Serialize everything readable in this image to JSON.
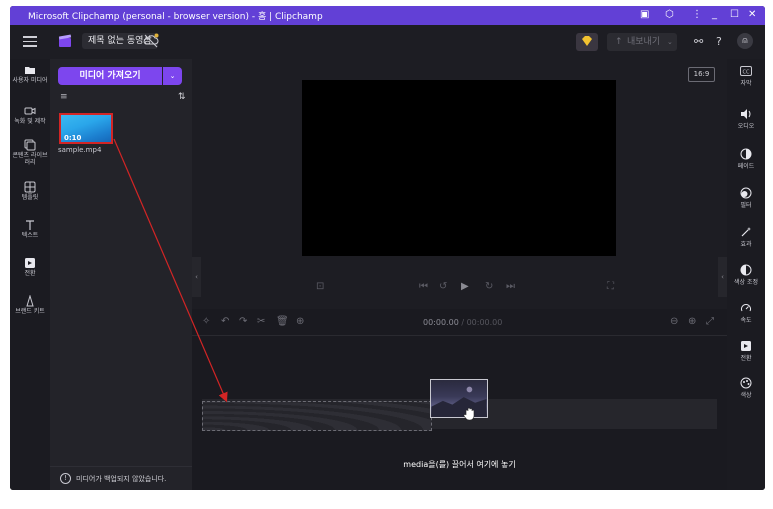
{
  "titlebar": {
    "title": "Microsoft Clipchamp (personal - browser version) - 홈 | Clipchamp"
  },
  "appbar": {
    "project_title": "제목 없는 동영상",
    "export_label": "내보내기"
  },
  "left_nav": [
    {
      "label": "사용자 미디어",
      "icon": "folder-icon"
    },
    {
      "label": "녹화 및 제작",
      "icon": "camera-icon"
    },
    {
      "label": "콘텐츠 라이브러리",
      "icon": "library-icon"
    },
    {
      "label": "템플릿",
      "icon": "templates-icon"
    },
    {
      "label": "텍스트",
      "icon": "text-icon"
    },
    {
      "label": "전환",
      "icon": "transitions-icon"
    },
    {
      "label": "브랜드 키트",
      "icon": "brand-kit-icon"
    }
  ],
  "media": {
    "import_label": "미디어 가져오기",
    "items": [
      {
        "name": "sample.mp4",
        "duration": "0:10"
      }
    ],
    "backup_notice": "미디어가 백업되지 않았습니다."
  },
  "preview": {
    "aspect_ratio": "16:9"
  },
  "right_nav": [
    {
      "label": "자막",
      "icon": "captions-icon"
    },
    {
      "label": "오디오",
      "icon": "audio-icon"
    },
    {
      "label": "페이드",
      "icon": "fade-icon"
    },
    {
      "label": "필터",
      "icon": "filter-icon"
    },
    {
      "label": "효과",
      "icon": "effects-icon"
    },
    {
      "label": "색상 조정",
      "icon": "color-adjust-icon"
    },
    {
      "label": "속도",
      "icon": "speed-icon"
    },
    {
      "label": "전환",
      "icon": "transitions-icon"
    },
    {
      "label": "색상",
      "icon": "color-icon"
    }
  ],
  "timeline": {
    "current_time": "00:00.00",
    "total_time": "/ 00:00.00",
    "drop_hint": "media을(를) 끌어서 여기에 놓기"
  },
  "colors": {
    "titlebar": "#6240d6",
    "accent": "#7d46ee",
    "highlight": "#d22525"
  }
}
